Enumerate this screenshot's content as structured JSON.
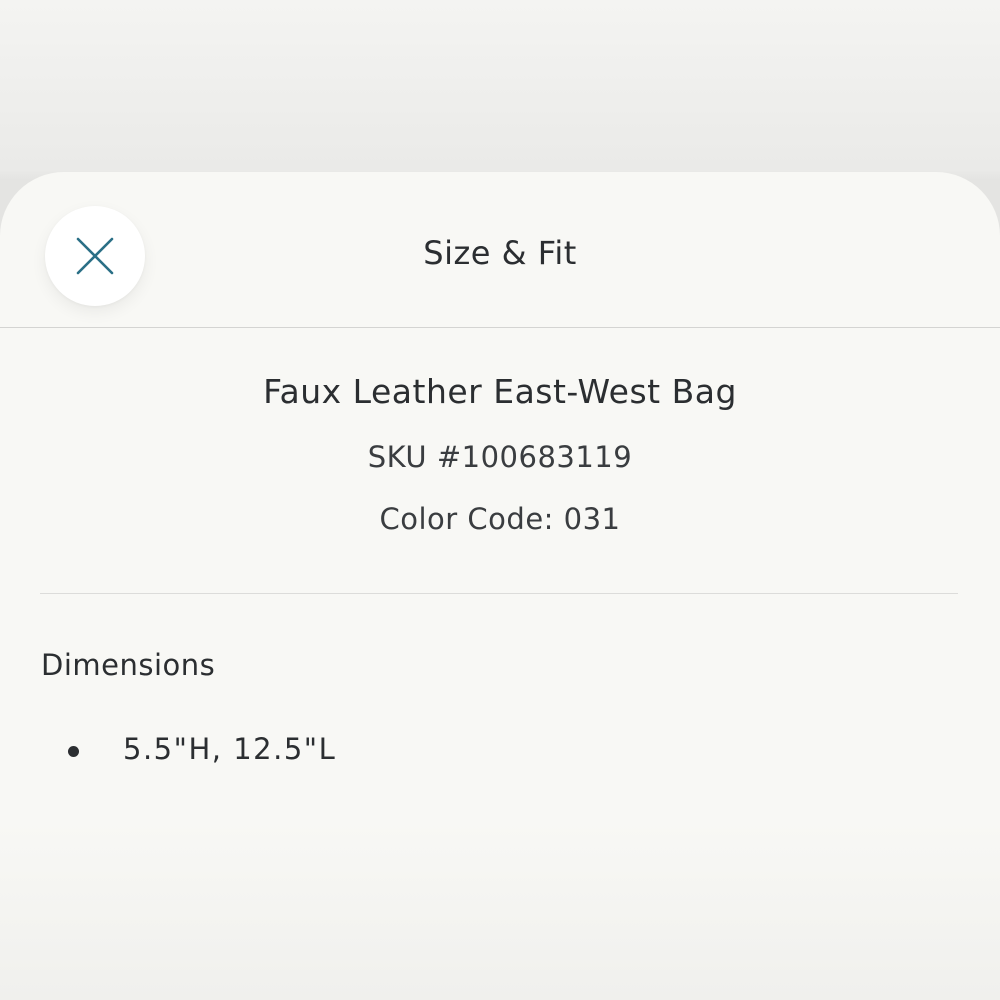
{
  "sheet": {
    "title": "Size & Fit",
    "close_icon": "close-icon"
  },
  "product": {
    "name": "Faux Leather East-West Bag",
    "sku": "SKU #100683119",
    "color_code": "Color Code: 031"
  },
  "dimensions": {
    "heading": "Dimensions",
    "items": [
      {
        "text": "5.5\"H, 12.5\"L"
      }
    ]
  },
  "colors": {
    "accent": "#2a6f86",
    "text": "#2b2e31",
    "sheet_background": "#f8f8f5",
    "divider": "#d4d4d2"
  }
}
